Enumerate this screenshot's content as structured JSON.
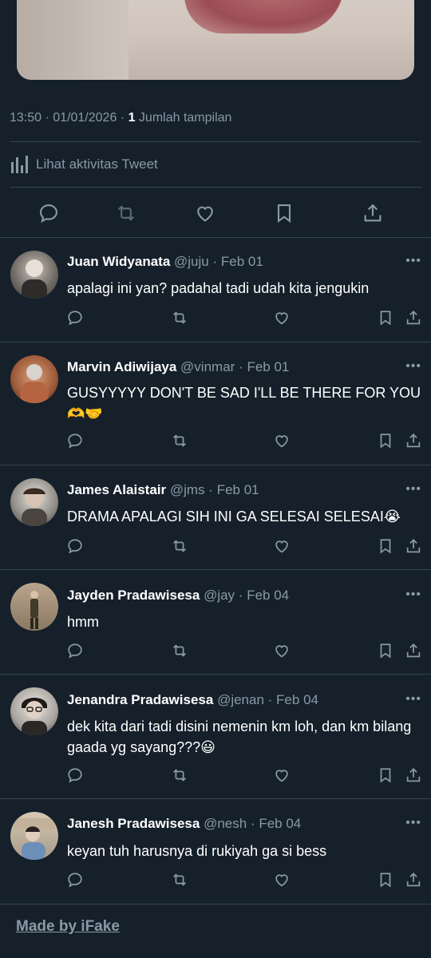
{
  "tweet": {
    "time": "13:50",
    "date": "01/01/2026",
    "views_count": "1",
    "views_label": "Jumlah tampilan",
    "activity_label": "Lihat aktivitas Tweet"
  },
  "replies": [
    {
      "name": "Juan Widyanata",
      "handle": "@juju",
      "date": "Feb 01",
      "text": "apalagi ini yan? padahal tadi udah kita jengukin"
    },
    {
      "name": "Marvin Adiwijaya",
      "handle": "@vinmar",
      "date": "Feb 01",
      "text": "GUSYYYYY DON'T BE SAD I'LL BE THERE FOR YOU 🫶🤝"
    },
    {
      "name": "James Alaistair",
      "handle": "@jms",
      "date": "Feb 01",
      "text": "DRAMA APALAGI SIH INI GA SELESAI SELESAI😭"
    },
    {
      "name": "Jayden Pradawisesa",
      "handle": "@jay",
      "date": "Feb 04",
      "text": "hmm"
    },
    {
      "name": "Jenandra Pradawisesa",
      "handle": "@jenan",
      "date": "Feb 04",
      "text": "dek kita dari tadi disini nemenin km loh, dan km bilang gaada yg sayang???😃"
    },
    {
      "name": "Janesh Pradawisesa",
      "handle": "@nesh",
      "date": "Feb 04",
      "text": "keyan tuh harusnya di rukiyah ga si bess"
    }
  ],
  "footer": {
    "made_by": "Made by iFake"
  },
  "icons": {
    "reply": "reply-icon",
    "retweet": "retweet-icon",
    "like": "heart-icon",
    "bookmark": "bookmark-icon",
    "share": "share-icon",
    "more": "more-icon",
    "activity": "bar-chart-icon"
  },
  "colors": {
    "background": "#15202b",
    "secondary_text": "#8b98a5",
    "divider": "#38444d"
  }
}
